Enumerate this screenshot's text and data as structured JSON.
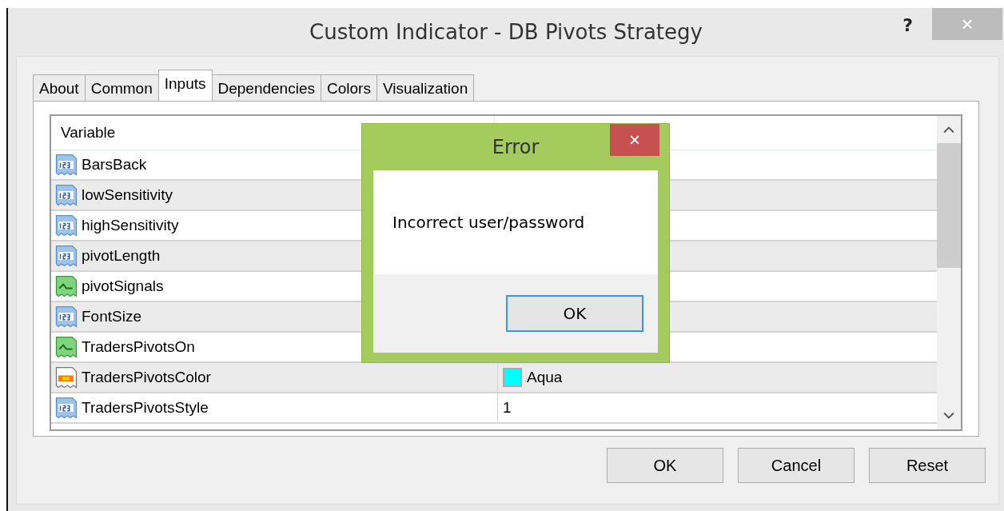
{
  "window": {
    "title": "Custom Indicator - DB Pivots Strategy",
    "help": "?",
    "close": "×"
  },
  "tabs": [
    {
      "label": "About",
      "selected": false
    },
    {
      "label": "Common",
      "selected": false
    },
    {
      "label": "Inputs",
      "selected": true
    },
    {
      "label": "Dependencies",
      "selected": false
    },
    {
      "label": "Colors",
      "selected": false
    },
    {
      "label": "Visualization",
      "selected": false
    }
  ],
  "table": {
    "columns": [
      "Variable"
    ],
    "rows": [
      {
        "kind": "number",
        "name": "BarsBack"
      },
      {
        "kind": "number",
        "name": "lowSensitivity"
      },
      {
        "kind": "number",
        "name": "highSensitivity"
      },
      {
        "kind": "number",
        "name": "pivotLength"
      },
      {
        "kind": "bool",
        "name": "pivotSignals"
      },
      {
        "kind": "number",
        "name": "FontSize"
      },
      {
        "kind": "bool",
        "name": "TradersPivotsOn"
      },
      {
        "kind": "color",
        "name": "TradersPivotsColor",
        "value": "Aqua",
        "color": "#00ffff"
      },
      {
        "kind": "number",
        "name": "TradersPivotsStyle",
        "value": "1"
      }
    ]
  },
  "buttons": [
    "OK",
    "Cancel",
    "Reset"
  ],
  "error_dialog": {
    "title": "Error",
    "close": "×",
    "message": "Incorrect user/password",
    "button": "OK"
  }
}
